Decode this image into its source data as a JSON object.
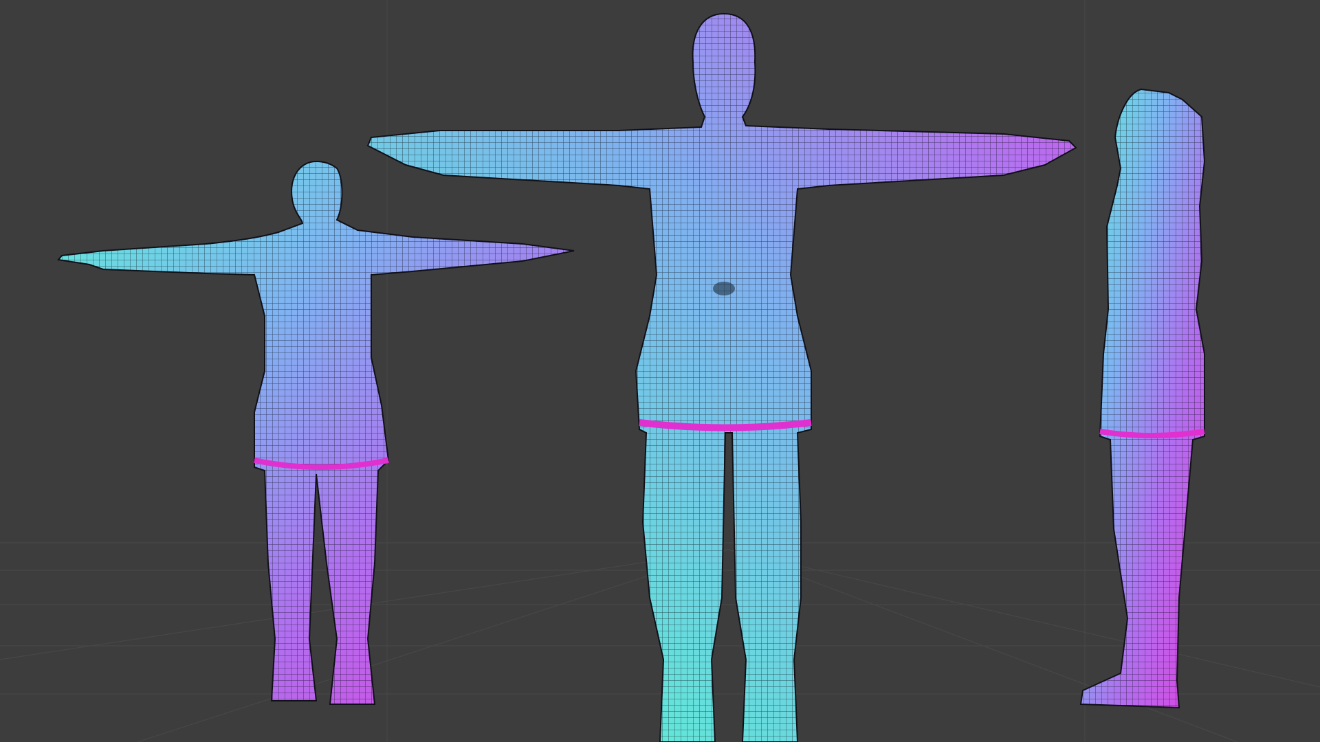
{
  "viewport": {
    "background_color": "#3d3d3d",
    "grid_color": "#474747",
    "mesh_gradient": [
      "#5ef0d8",
      "#7aa8f0",
      "#c060f0",
      "#e040e0"
    ],
    "wire_color": "#101018"
  },
  "models": [
    {
      "view": "back"
    },
    {
      "view": "front"
    },
    {
      "view": "side"
    }
  ]
}
